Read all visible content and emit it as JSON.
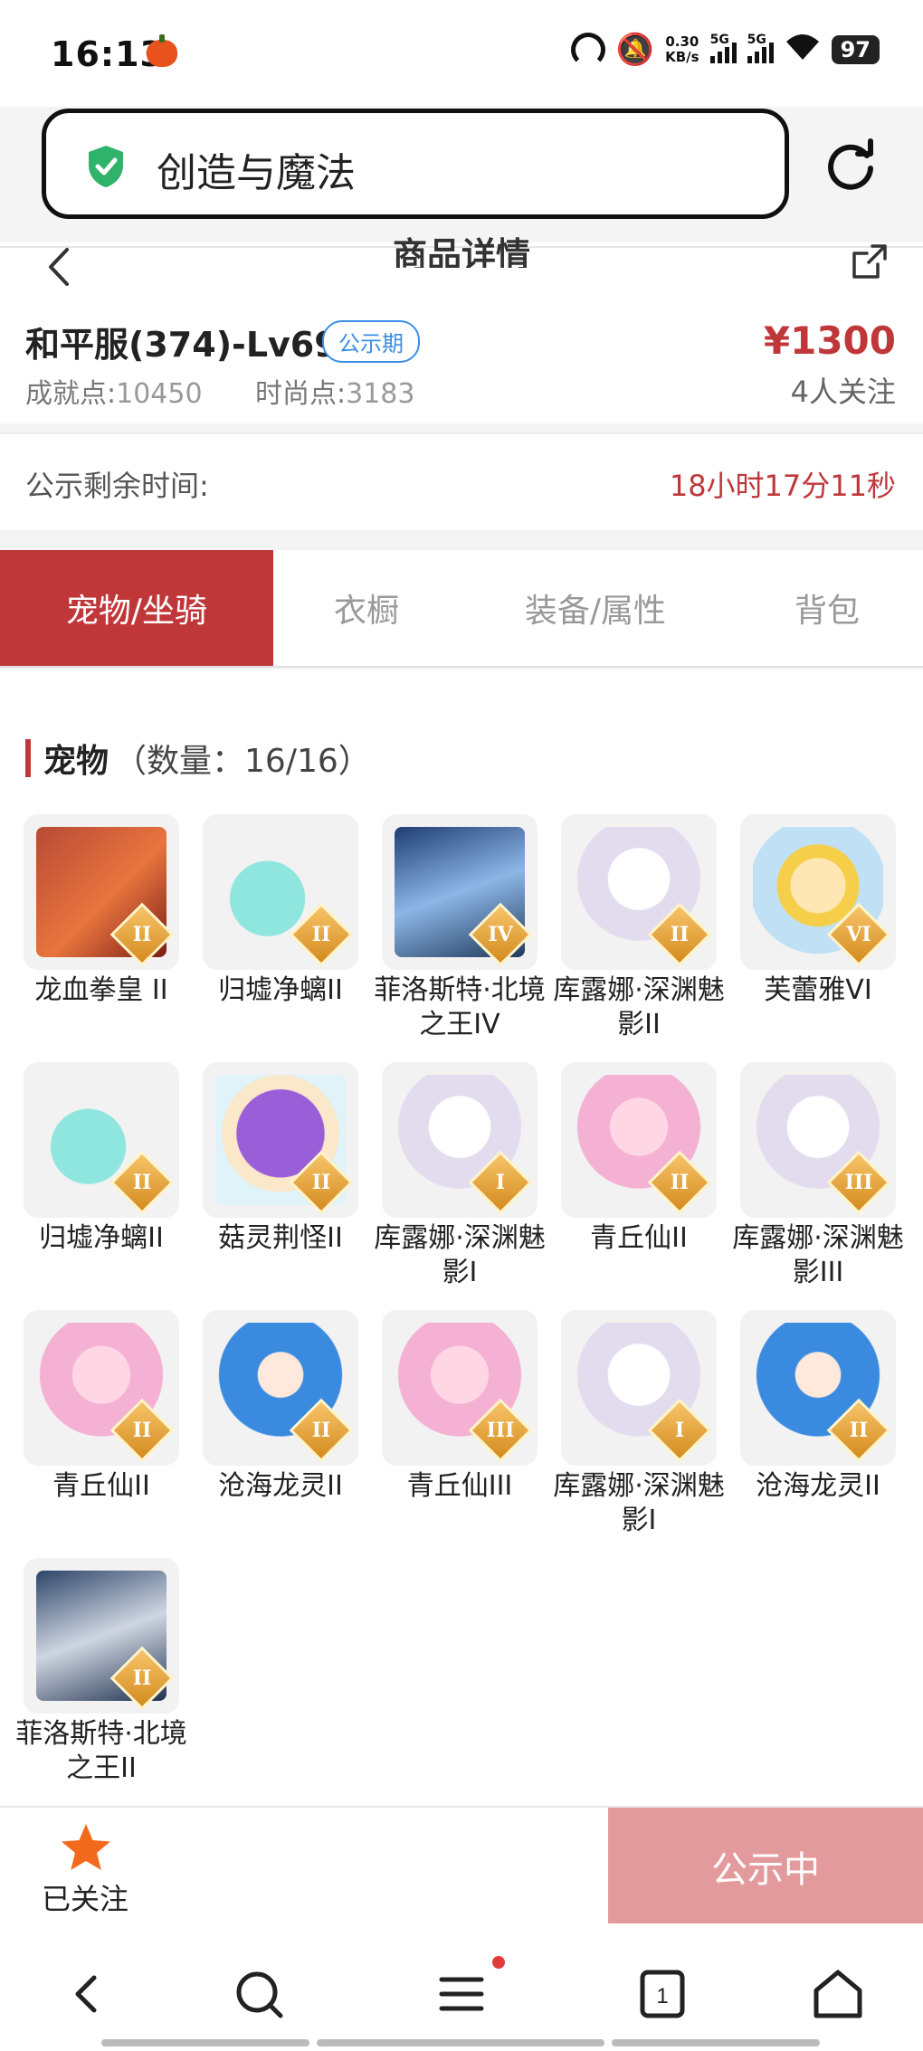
{
  "status_bar": {
    "time": "16:13",
    "net_speed_value": "0.30",
    "net_speed_unit": "KB/s",
    "signal1_label": "5G",
    "signal2_label": "5G",
    "battery": "97"
  },
  "browser": {
    "address_text": "创造与魔法"
  },
  "header": {
    "title": "商品详情"
  },
  "product": {
    "name": "和平服(374)-Lv69",
    "badge": "公示期",
    "price": "¥1300",
    "followers": "4人关注",
    "achievement_label": "成就点:",
    "achievement_value": "10450",
    "fashion_label": "时尚点:",
    "fashion_value": "3183"
  },
  "countdown": {
    "label": "公示剩余时间:",
    "value": "18小时17分11秒"
  },
  "tabs": [
    {
      "label": "宠物/坐骑",
      "active": true
    },
    {
      "label": "衣橱",
      "active": false
    },
    {
      "label": "装备/属性",
      "active": false
    },
    {
      "label": "背包",
      "active": false
    }
  ],
  "section": {
    "title": "宠物",
    "count": "（数量：16/16）"
  },
  "pets": [
    {
      "name": "龙血拳皇 II",
      "rank": "II",
      "art": "red"
    },
    {
      "name": "归墟净螭II",
      "rank": "II",
      "art": "cyan"
    },
    {
      "name": "菲洛斯特·北境之王IV",
      "rank": "IV",
      "art": "dark"
    },
    {
      "name": "库露娜·深渊魅影II",
      "rank": "II",
      "art": "white"
    },
    {
      "name": "芙蕾雅VI",
      "rank": "VI",
      "art": "gold"
    },
    {
      "name": "归墟净螭II",
      "rank": "II",
      "art": "cyan"
    },
    {
      "name": "菇灵荆怪II",
      "rank": "II",
      "art": "purple"
    },
    {
      "name": "库露娜·深渊魅影I",
      "rank": "I",
      "art": "white"
    },
    {
      "name": "青丘仙II",
      "rank": "II",
      "art": "pink"
    },
    {
      "name": "库露娜·深渊魅影III",
      "rank": "III",
      "art": "white"
    },
    {
      "name": "青丘仙II",
      "rank": "II",
      "art": "pink"
    },
    {
      "name": "沧海龙灵II",
      "rank": "II",
      "art": "blue"
    },
    {
      "name": "青丘仙III",
      "rank": "III",
      "art": "pink"
    },
    {
      "name": "库露娜·深渊魅影I",
      "rank": "I",
      "art": "white"
    },
    {
      "name": "沧海龙灵II",
      "rank": "II",
      "art": "blue"
    },
    {
      "name": "菲洛斯特·北境之王II",
      "rank": "II",
      "art": "dark2"
    }
  ],
  "action_bar": {
    "favorite_label": "已关注",
    "public_button": "公示中"
  },
  "bottom_nav": {
    "tab_count": "1"
  },
  "colors": {
    "brand_red": "#c0373a",
    "badge_blue": "#3a8ee6",
    "shield_green": "#2fb36b",
    "star_orange": "#f26a1b",
    "disabled_button": "#e39a9c"
  }
}
